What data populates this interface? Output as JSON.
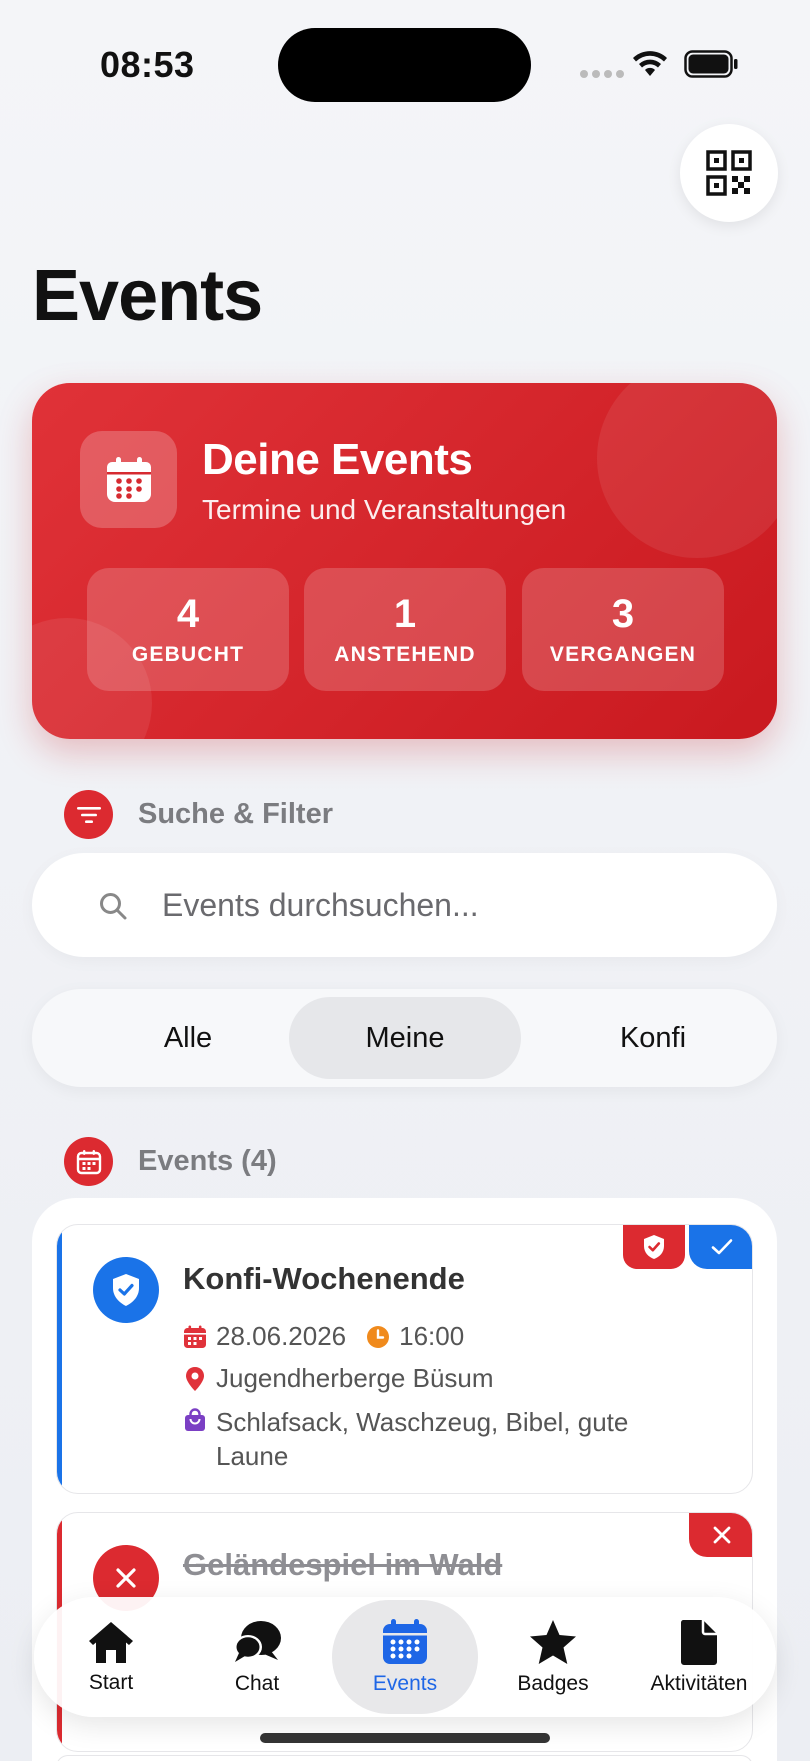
{
  "status": {
    "time": "08:53"
  },
  "page": {
    "title": "Events"
  },
  "hero": {
    "title": "Deine Events",
    "subtitle": "Termine und Veranstaltungen",
    "stats": [
      {
        "value": "4",
        "label": "GEBUCHT"
      },
      {
        "value": "1",
        "label": "ANSTEHEND"
      },
      {
        "value": "3",
        "label": "VERGANGEN"
      }
    ]
  },
  "filter": {
    "section_label": "Suche & Filter",
    "search_placeholder": "Events durchsuchen...",
    "search_value": "",
    "segments": [
      "Alle",
      "Meine",
      "Konfi"
    ],
    "selected_segment": "Meine"
  },
  "list": {
    "section_label": "Events (4)",
    "events": [
      {
        "title": "Konfi-Wochenende",
        "date": "28.06.2026",
        "time": "16:00",
        "location": "Jugendherberge Büsum",
        "bring_line1": "Schlafsack, Waschzeug, Bibel, gute",
        "bring_line2": "Laune",
        "status": "booked",
        "accent": "#1a73e8"
      },
      {
        "title": "Geländespiel im Wald",
        "status": "cancelled",
        "accent": "#dc2a30"
      }
    ]
  },
  "tabbar": {
    "tabs": [
      {
        "label": "Start",
        "icon": "house-icon"
      },
      {
        "label": "Chat",
        "icon": "chat-bubbles-icon"
      },
      {
        "label": "Events",
        "icon": "calendar-icon"
      },
      {
        "label": "Badges",
        "icon": "star-icon"
      },
      {
        "label": "Aktivitäten",
        "icon": "document-icon"
      }
    ],
    "active": "Events"
  },
  "colors": {
    "brand_red": "#dc2a30",
    "accent_blue": "#1a73e8",
    "date_red": "#e0323a",
    "clock_orange": "#f08a1c",
    "bag_purple": "#7b3fc4"
  }
}
